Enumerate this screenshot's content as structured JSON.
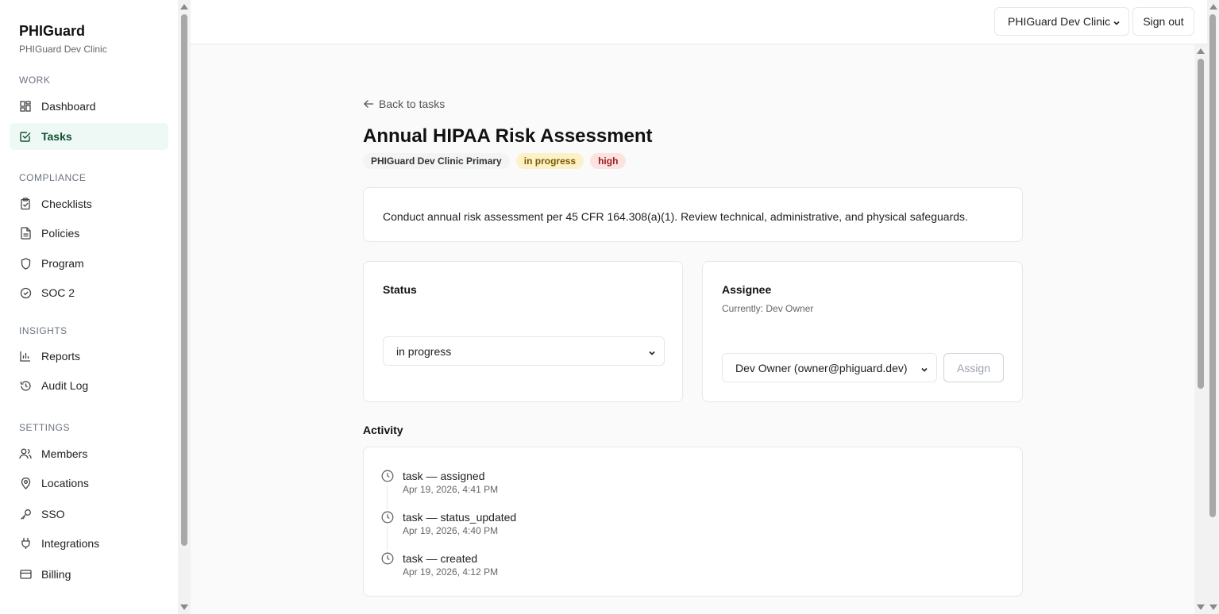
{
  "sidebar": {
    "brand_title": "PHIGuard",
    "brand_sub": "PHIGuard Dev Clinic",
    "sections": {
      "work": "WORK",
      "compliance": "COMPLIANCE",
      "insights": "INSIGHTS",
      "settings": "SETTINGS"
    },
    "items": {
      "dashboard": "Dashboard",
      "tasks": "Tasks",
      "checklists": "Checklists",
      "policies": "Policies",
      "program": "Program",
      "soc2": "SOC 2",
      "reports": "Reports",
      "audit_log": "Audit Log",
      "members": "Members",
      "locations": "Locations",
      "sso": "SSO",
      "integrations": "Integrations",
      "billing": "Billing"
    },
    "active_item": "tasks"
  },
  "topbar": {
    "org_selected": "PHIGuard Dev Clinic",
    "sign_out_label": "Sign out"
  },
  "task": {
    "back_label": "Back to tasks",
    "title": "Annual HIPAA Risk Assessment",
    "location_badge": "PHIGuard Dev Clinic Primary",
    "status_badge": "in progress",
    "priority_badge": "high",
    "description": "Conduct annual risk assessment per 45 CFR 164.308(a)(1). Review technical, administrative, and physical safeguards."
  },
  "status_card": {
    "title": "Status",
    "selected": "in progress"
  },
  "assignee_card": {
    "title": "Assignee",
    "current": "Currently: Dev Owner",
    "selected": "Dev Owner (owner@phiguard.dev)",
    "assign_label": "Assign"
  },
  "activity": {
    "title": "Activity",
    "items": [
      {
        "text": "task — assigned",
        "time": "Apr 19, 2026, 4:41 PM"
      },
      {
        "text": "task — status_updated",
        "time": "Apr 19, 2026, 4:40 PM"
      },
      {
        "text": "task — created",
        "time": "Apr 19, 2026, 4:12 PM"
      }
    ]
  },
  "colors": {
    "accent": "#0f5132",
    "active_bg": "#eef8f4",
    "status_badge_bg": "#fdf1c7",
    "priority_badge_bg": "#fde2e2"
  }
}
